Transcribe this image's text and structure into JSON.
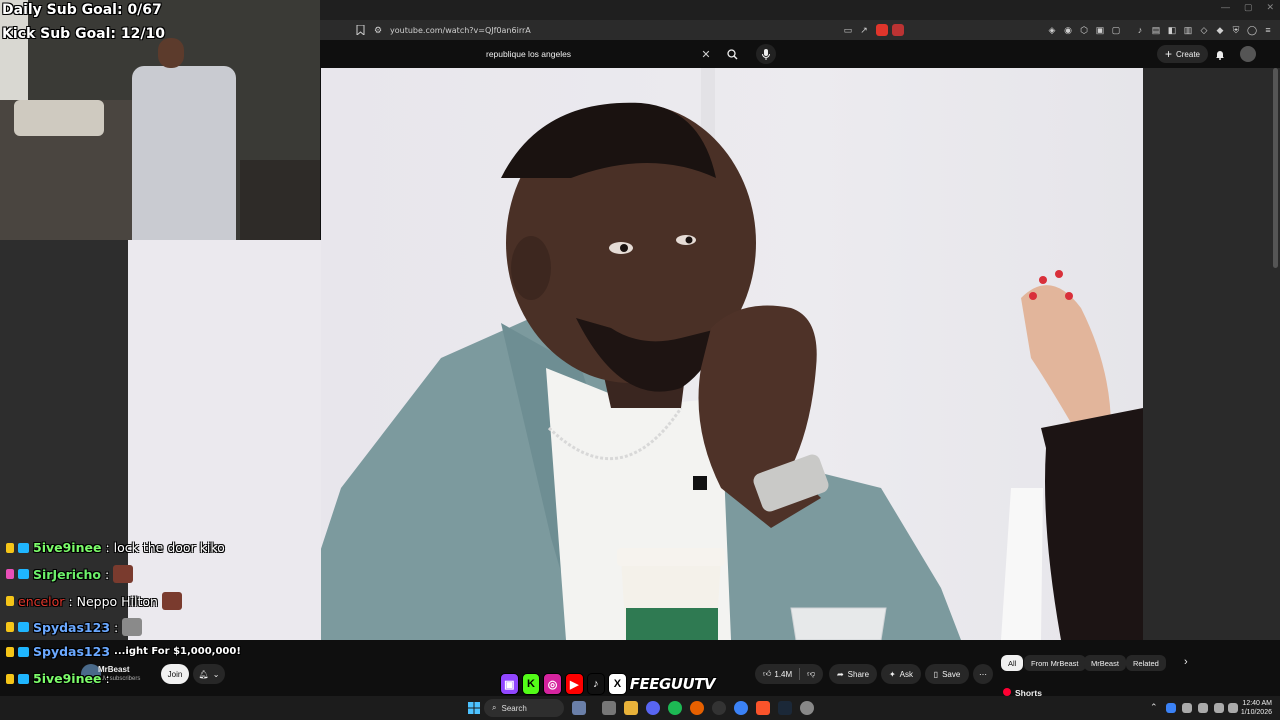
{
  "stream_overlay": {
    "daily_sub_goal": "Daily Sub Goal: 0/67",
    "kick_sub_goal": "Kick Sub Goal: 12/10",
    "brand_logo_text": "FEEGUUTV"
  },
  "chat": [
    {
      "user": "5ive9inee",
      "user_color": "#7cfc6a",
      "message": " : lock the door kiko"
    },
    {
      "user": "SirJericho",
      "user_color": "#6cf06a",
      "message": " :"
    },
    {
      "user": "encelor",
      "user_color": "#e0352b",
      "message": " : Neppo Hilton"
    },
    {
      "user": "Spydas123",
      "user_color": "#6aa8ff",
      "message": " :"
    },
    {
      "user": "Spydas123",
      "user_color": "#6aa8ff",
      "message": "...ight For $1,000,000!"
    },
    {
      "user": "5ive9inee",
      "user_color": "#7cfc6a",
      "message": " :"
    },
    {
      "user": "5ive9inee",
      "user_color": "#7cfc6a",
      "message": " :"
    }
  ],
  "browser": {
    "url": "youtube.com/watch?v=QJf0an6irrA"
  },
  "youtube": {
    "search_query": "republique los angeles",
    "create_label": "Create",
    "channel_name": "MrBeast",
    "channel_subs": "...M subscribers",
    "join_label": "Join",
    "like_count": "1.4M",
    "share_label": "Share",
    "ask_label": "Ask",
    "save_label": "Save",
    "chips": [
      "All",
      "From MrBeast",
      "MrBeast",
      "Related"
    ],
    "shorts_label": "Shorts"
  },
  "taskbar": {
    "search_label": "Search",
    "time": "12:40 AM",
    "date": "1/10/2026"
  },
  "colors": {
    "accent_red": "#ff0033",
    "yt_bg": "#0f0f0f",
    "chip_bg": "#272727"
  }
}
